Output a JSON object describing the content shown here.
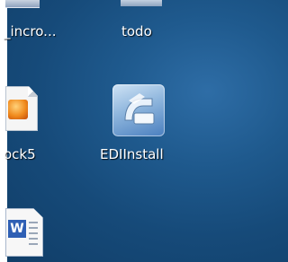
{
  "desktop": {
    "icons": [
      {
        "label": "_incro..."
      },
      {
        "label": "todo"
      },
      {
        "label": "ock5"
      },
      {
        "label": "EDIInstall"
      },
      {
        "label": ""
      }
    ]
  }
}
